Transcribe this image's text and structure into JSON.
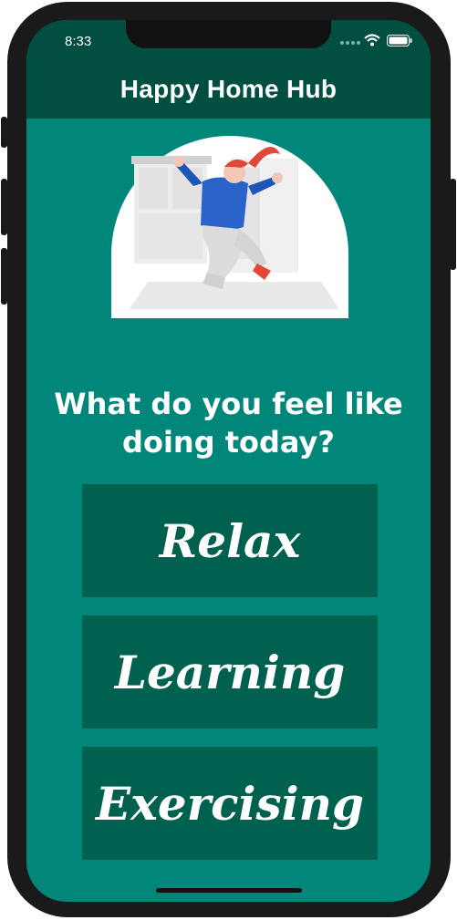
{
  "status": {
    "time": "8:33"
  },
  "app": {
    "title": "Happy Home Hub"
  },
  "prompt": {
    "question_line1": "What do you feel like",
    "question_line2": "doing today?"
  },
  "choices": [
    {
      "label": "Relax"
    },
    {
      "label": "Learning"
    },
    {
      "label": "Exercising"
    }
  ],
  "colors": {
    "background": "#00877a",
    "header": "#004f40",
    "button": "#00614f",
    "text": "#ffffff"
  }
}
